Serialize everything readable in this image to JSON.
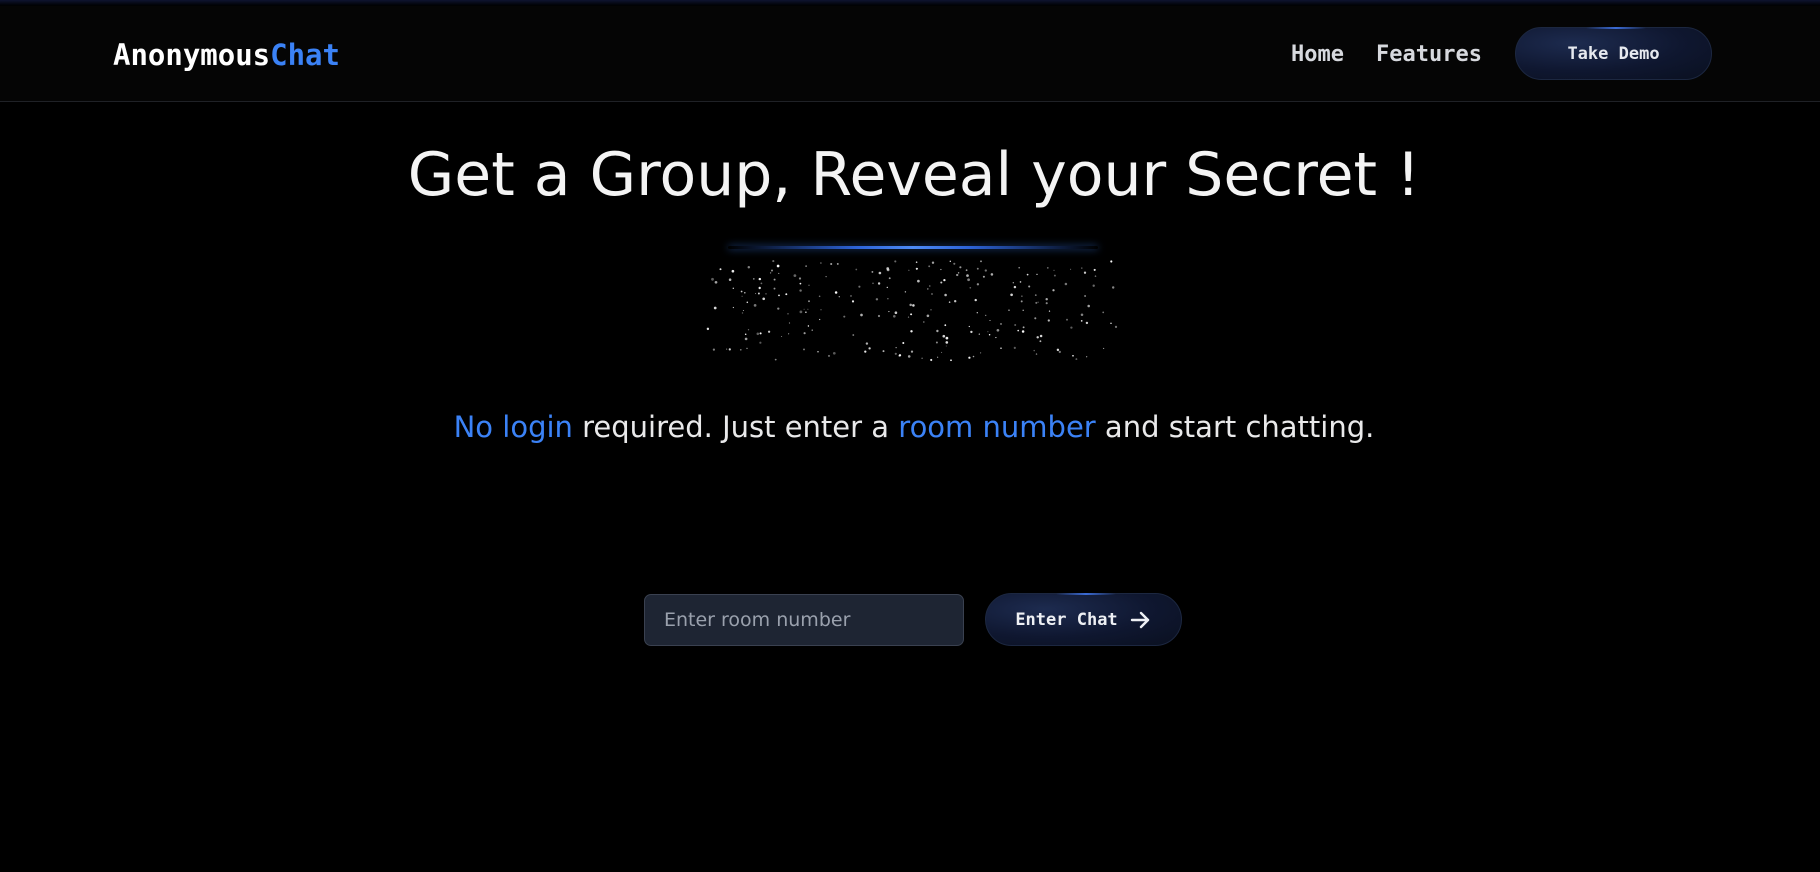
{
  "brand": {
    "name_main": "Anonymous",
    "name_accent": "Chat"
  },
  "nav": {
    "items": [
      {
        "label": "Home"
      },
      {
        "label": "Features"
      }
    ],
    "cta_label": "Take Demo"
  },
  "hero": {
    "title": "Get a Group, Reveal your Secret !",
    "subtitle": {
      "highlight_1": "No login",
      "text_1": " required. Just enter a ",
      "highlight_2": "room number",
      "text_2": " and start chatting."
    }
  },
  "room_form": {
    "input_placeholder": "Enter room number",
    "input_value": "",
    "submit_label": "Enter Chat",
    "submit_icon": "arrow-right-icon"
  },
  "colors": {
    "background": "#000000",
    "accent": "#3b82f6",
    "button_bg": "#0f1730",
    "input_bg": "#1e2533"
  }
}
